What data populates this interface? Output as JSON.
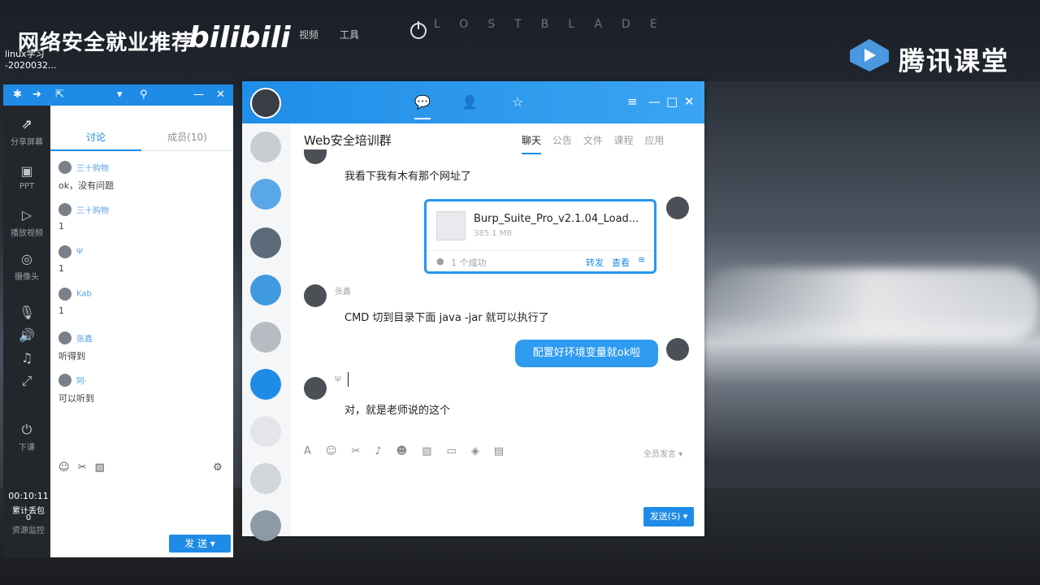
{
  "overlay": {
    "title": "网络安全就业推荐",
    "bili_logo": "bilibili",
    "menu_items": [
      "视频",
      "工具"
    ],
    "ghost_text": "LOSTBLADE",
    "file_label_1": "linux学习",
    "file_label_2": "-2020032..."
  },
  "tencent": {
    "brand": "腾讯课堂"
  },
  "rail": {
    "share_screen": "分享屏幕",
    "ppt": "PPT",
    "play_video": "播放视频",
    "camera": "摄像头",
    "end_class": "下课",
    "time": "00:10:11",
    "packet_loss": "累计丢包",
    "loss_value": "0",
    "resource_monitor": "资源监控"
  },
  "mini_panel": {
    "tab_discuss": "讨论",
    "tab_members": "成员(10)",
    "messages": [
      {
        "name": "三十购物",
        "text": "ok，没有问题"
      },
      {
        "name": "三十购物",
        "text": "1"
      },
      {
        "name": "Ψ",
        "text": "1"
      },
      {
        "name": "Kab",
        "text": "1"
      },
      {
        "name": "张鑫",
        "text": "听得到"
      },
      {
        "name": "阿·",
        "text": "可以听到"
      }
    ],
    "send": "发 送"
  },
  "window": {
    "group_name": "Web安全培训群",
    "tabs": [
      "聊天",
      "公告",
      "文件",
      "课程",
      "应用"
    ],
    "msg_top": "我看下我有木有那个网址了",
    "file": {
      "name": "Burp_Suite_Pro_v2.1.04_Load...",
      "size": "385.1 MB",
      "status": "1 个成功",
      "forward": "转发",
      "view": "查看"
    },
    "sender_1": "张鑫",
    "msg_cmd": "CMD  切到目录下面  java  -jar  就可以执行了",
    "msg_blue": "配置好环境变量就ok啦",
    "sender_2": "Ψ",
    "msg_last": "对，就是老师说的这个",
    "mode": "全员发言",
    "send": "发送(S)"
  },
  "colors": {
    "accent": "#1e8ce6",
    "bubble": "#2f9bf0",
    "rail": "#23262b"
  }
}
